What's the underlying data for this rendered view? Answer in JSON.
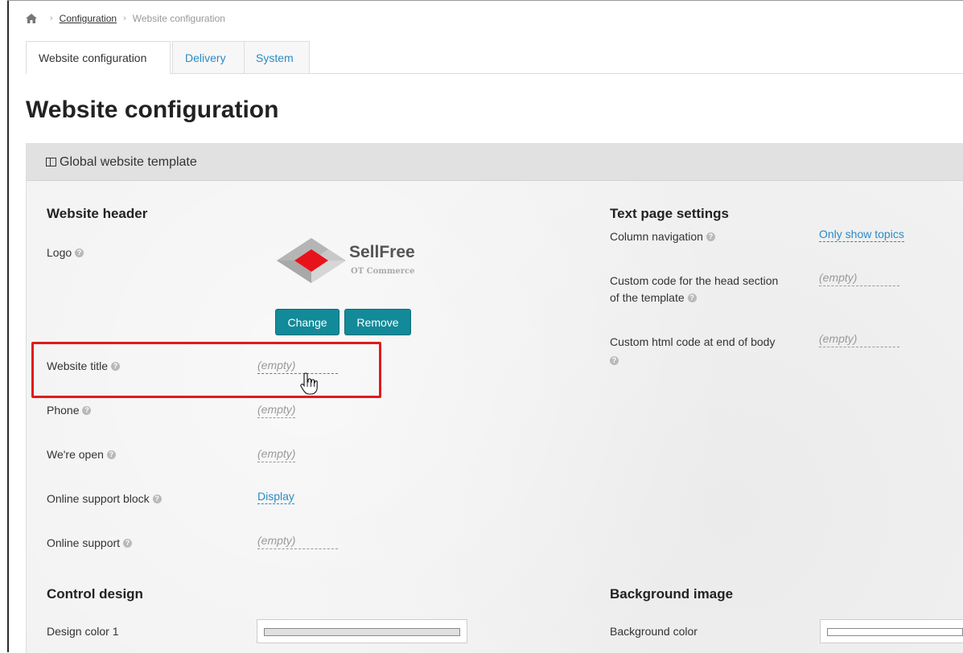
{
  "breadcrumb": {
    "home_icon": "home-icon",
    "link": "Configuration",
    "current": "Website configuration"
  },
  "tabs": [
    {
      "label": "Website configuration",
      "active": true
    },
    {
      "label": "Delivery",
      "active": false
    },
    {
      "label": "System",
      "active": false
    }
  ],
  "page_title": "Website configuration",
  "panel": {
    "header": "Global website template",
    "header_icon": "columns-icon"
  },
  "website_header": {
    "title": "Website header",
    "logo": {
      "label": "Logo",
      "brand_name": "SellFree",
      "brand_sub": "OT Commerce",
      "change_label": "Change",
      "remove_label": "Remove"
    },
    "fields": [
      {
        "label": "Website title",
        "value": "(empty)"
      },
      {
        "label": "Phone",
        "value": "(empty)"
      },
      {
        "label": "We're open",
        "value": "(empty)"
      },
      {
        "label": "Online support block",
        "value": "Display"
      },
      {
        "label": "Online support",
        "value": "(empty)"
      }
    ]
  },
  "text_page_settings": {
    "title": "Text page settings",
    "fields": [
      {
        "label": "Column navigation",
        "value": "Only show topics"
      },
      {
        "label_line1": "Custom code for the head section",
        "label_line2": "of the template",
        "value": "(empty)"
      },
      {
        "label": "Custom html code at end of body",
        "value": "(empty)"
      }
    ]
  },
  "control_design": {
    "title": "Control design",
    "fields": [
      {
        "label": "Design color 1"
      }
    ]
  },
  "background_image": {
    "title": "Background image",
    "fields": [
      {
        "label": "Background color"
      }
    ]
  },
  "colors": {
    "accent_button": "#138a99",
    "link": "#2a8ac7",
    "highlight": "#e01b1b",
    "logo_red": "#e8121b"
  }
}
